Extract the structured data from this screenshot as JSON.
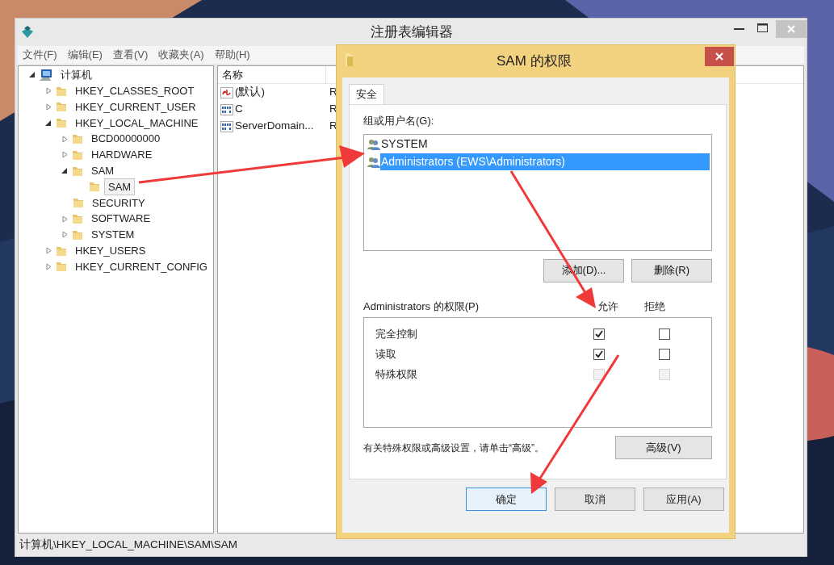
{
  "window": {
    "title": "注册表编辑器"
  },
  "menu": [
    "文件(F)",
    "编辑(E)",
    "查看(V)",
    "收藏夹(A)",
    "帮助(H)"
  ],
  "tree": [
    {
      "label": "计算机",
      "kind": "root",
      "expanded": true,
      "selected": false,
      "children": [
        {
          "label": "HKEY_CLASSES_ROOT",
          "kind": "branch",
          "expanded": false,
          "selected": false
        },
        {
          "label": "HKEY_CURRENT_USER",
          "kind": "branch",
          "expanded": false,
          "selected": false
        },
        {
          "label": "HKEY_LOCAL_MACHINE",
          "kind": "branch",
          "expanded": true,
          "selected": false,
          "children": [
            {
              "label": "BCD00000000",
              "kind": "branch",
              "expanded": false,
              "selected": false
            },
            {
              "label": "HARDWARE",
              "kind": "branch",
              "expanded": false,
              "selected": false
            },
            {
              "label": "SAM",
              "kind": "branch",
              "expanded": true,
              "selected": false,
              "children": [
                {
                  "label": "SAM",
                  "kind": "leaf",
                  "selected": true
                }
              ]
            },
            {
              "label": "SECURITY",
              "kind": "leaf",
              "selected": false
            },
            {
              "label": "SOFTWARE",
              "kind": "branch",
              "expanded": false,
              "selected": false
            },
            {
              "label": "SYSTEM",
              "kind": "branch",
              "expanded": false,
              "selected": false
            }
          ]
        },
        {
          "label": "HKEY_USERS",
          "kind": "branch",
          "expanded": false,
          "selected": false
        },
        {
          "label": "HKEY_CURRENT_CONFIG",
          "kind": "branch",
          "expanded": false,
          "selected": false
        }
      ]
    }
  ],
  "values": {
    "columns": [
      "名称"
    ],
    "rows": [
      {
        "name": "(默认)",
        "kind": "string",
        "type": "R"
      },
      {
        "name": "C",
        "kind": "binary",
        "type": "R"
      },
      {
        "name": "ServerDomain...",
        "kind": "binary",
        "type": "R"
      }
    ]
  },
  "status_bar": "计算机\\HKEY_LOCAL_MACHINE\\SAM\\SAM",
  "dialog": {
    "title": "SAM 的权限",
    "tabs": [
      {
        "label": "安全",
        "selected": true
      }
    ],
    "users_label": "组或用户名(G):",
    "users": [
      {
        "name": "SYSTEM",
        "selected": false
      },
      {
        "name": "Administrators (EWS\\Administrators)",
        "selected": true
      }
    ],
    "user_buttons": [
      "添加(D)...",
      "删除(R)"
    ],
    "permissions_label": "Administrators 的权限(P)",
    "allow_header": "允许",
    "deny_header": "拒绝",
    "permissions": [
      {
        "name": "完全控制",
        "allow": {
          "checked": true,
          "disabled": false
        },
        "deny": {
          "checked": false,
          "disabled": false
        }
      },
      {
        "name": "读取",
        "allow": {
          "checked": true,
          "disabled": false
        },
        "deny": {
          "checked": false,
          "disabled": false
        }
      },
      {
        "name": "特殊权限",
        "allow": {
          "checked": false,
          "disabled": true
        },
        "deny": {
          "checked": false,
          "disabled": true
        }
      }
    ],
    "note": "有关特殊权限或高级设置，请单击“高级”。",
    "advanced_button": "高级(V)",
    "buttons": [
      {
        "label": "确定",
        "selected": true
      },
      {
        "label": "取消",
        "selected": false
      },
      {
        "label": "应用(A)",
        "selected": false
      }
    ]
  }
}
